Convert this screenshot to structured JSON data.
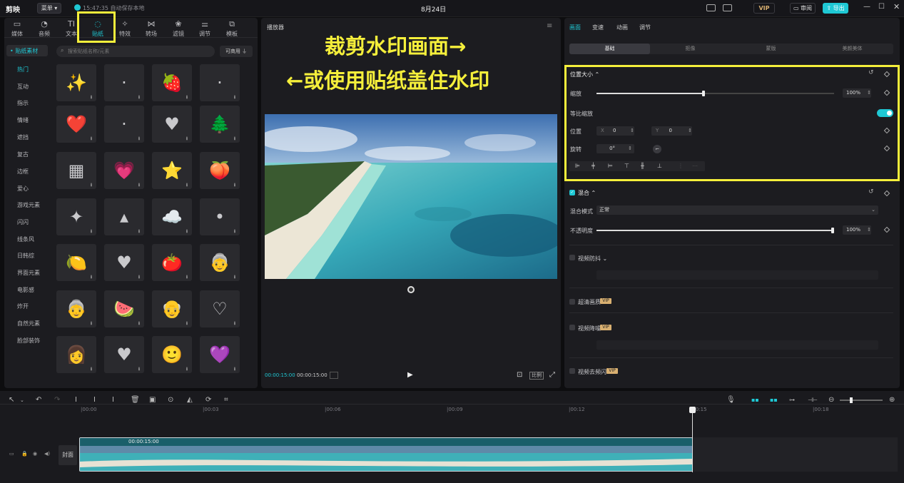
{
  "app": {
    "name": "剪映",
    "menu": "菜单",
    "autosave": "15:47:35 自动保存本地",
    "project_title": "8月24日",
    "vip": "VIP",
    "review": "审阅",
    "export": "导出"
  },
  "tools": [
    {
      "label": "媒体",
      "icon": "media-icon"
    },
    {
      "label": "音频",
      "icon": "audio-icon"
    },
    {
      "label": "文本",
      "icon": "text-icon"
    },
    {
      "label": "贴纸",
      "icon": "sticker-icon"
    },
    {
      "label": "特效",
      "icon": "effects-icon"
    },
    {
      "label": "转场",
      "icon": "transition-icon"
    },
    {
      "label": "滤镜",
      "icon": "filter-icon"
    },
    {
      "label": "调节",
      "icon": "adjust-icon"
    },
    {
      "label": "模板",
      "icon": "template-icon"
    }
  ],
  "sticker_panel": {
    "active_category": "贴纸素材",
    "search_placeholder": "搜索贴纸名称/元素",
    "filter_label": "可商用",
    "categories": [
      "热门",
      "互动",
      "指示",
      "情绪",
      "遮挡",
      "复古",
      "边框",
      "爱心",
      "游戏元素",
      "闪闪",
      "线条风",
      "日韩综",
      "界面元素",
      "电影感",
      "炸开",
      "自然元素",
      "脸部装饰"
    ],
    "stickers": [
      "✨",
      "·",
      "🍓",
      "·",
      "❤️",
      "·",
      "♥",
      "🌲",
      "▦",
      "💗",
      "⭐",
      "🍑",
      "✦",
      "▴",
      "☁️",
      "•",
      "🍋",
      "♥",
      "🍅",
      "👵",
      "👵",
      "🍉",
      "👴",
      "♡",
      "👩",
      "♥",
      "🙂",
      "💜"
    ]
  },
  "player": {
    "title": "播放器",
    "current_time": "00:00:15:00",
    "total_time": "00:00:15:00",
    "ratio_label": "比例"
  },
  "annotation": {
    "line1": "裁剪水印画面→",
    "line2": "←或使用贴纸盖住水印"
  },
  "inspector": {
    "tabs": [
      "画面",
      "变速",
      "动画",
      "调节"
    ],
    "subtabs": [
      "基础",
      "抠像",
      "蒙版",
      "美颜美体"
    ],
    "position_size": {
      "title": "位置大小",
      "scale_label": "缩放",
      "scale_value": "100%",
      "scale_fraction": 0.45,
      "uniform_label": "等比缩放",
      "position_label": "位置",
      "x_label": "X",
      "x_value": "0",
      "y_label": "Y",
      "y_value": "0",
      "rotate_label": "旋转",
      "rotate_value": "0°"
    },
    "blend": {
      "title": "混合",
      "mode_label": "混合模式",
      "mode_value": "正常",
      "opacity_label": "不透明度",
      "opacity_value": "100%",
      "opacity_fraction": 1.0
    },
    "options": [
      "视频防抖",
      "超清画质",
      "视频降噪",
      "视频去频闪"
    ]
  },
  "timeline": {
    "ticks": [
      "00:00",
      "00:03",
      "00:06",
      "00:09",
      "00:12",
      "00:15",
      "00:18"
    ],
    "clip_time": "00:00:15:00",
    "cover_label": "封面"
  },
  "colors": {
    "accent": "#1fc8d4",
    "highlight": "#f5ef3b",
    "vip": "#d9b071"
  }
}
